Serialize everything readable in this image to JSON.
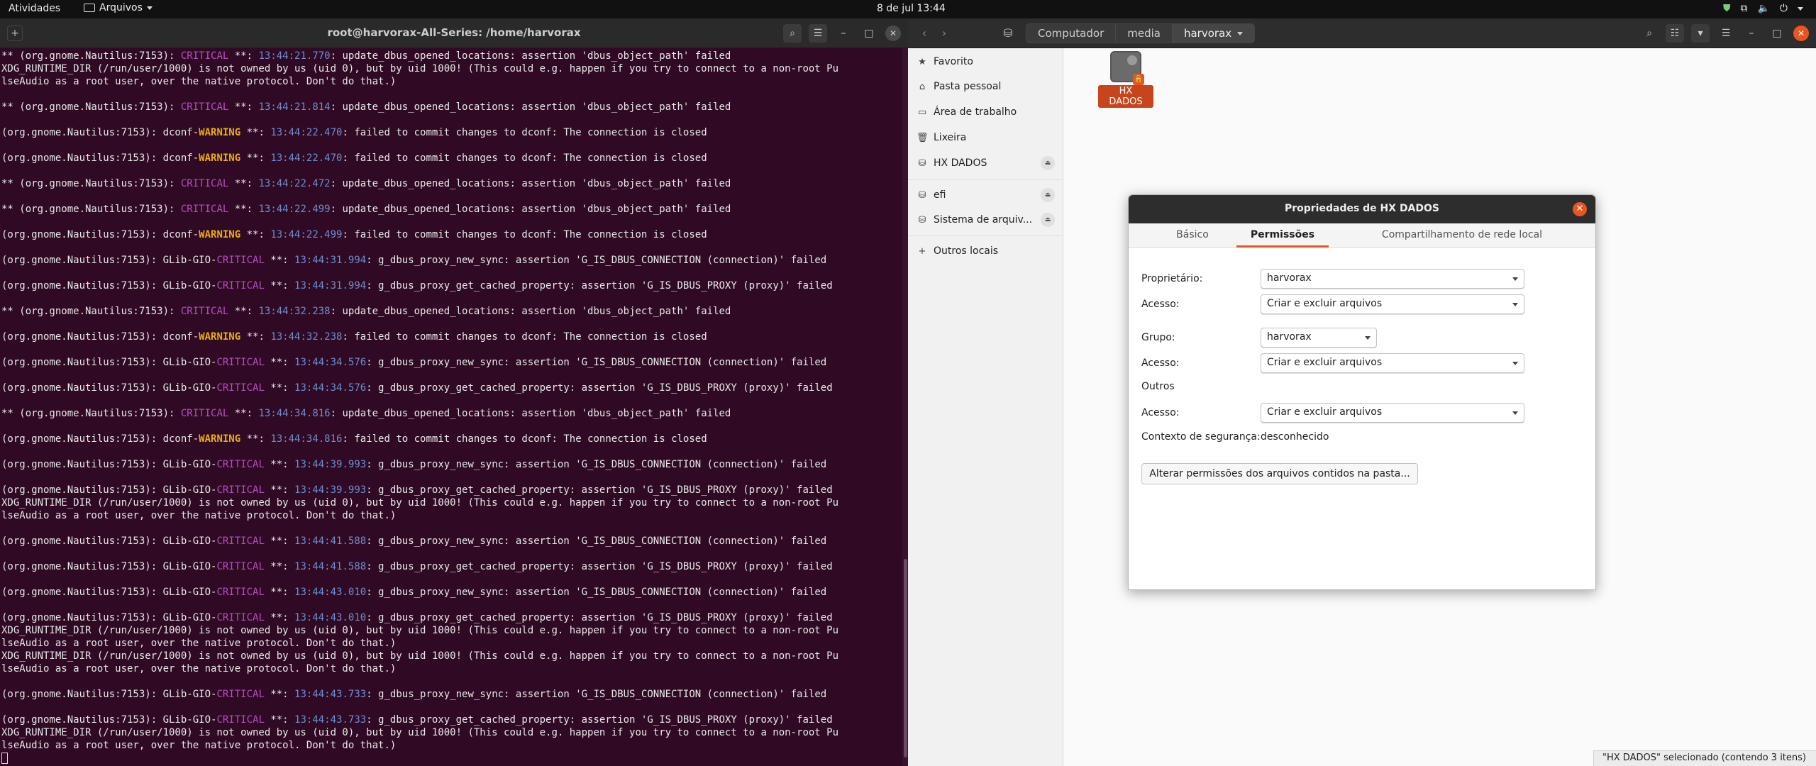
{
  "topbar": {
    "activities": "Atividades",
    "app_menu": "Arquivos",
    "clock": "8 de jul  13:44"
  },
  "terminal": {
    "title": "root@harvorax-All-Series: /home/harvorax",
    "lines": [
      [
        [
          "** (org.gnome.Nautilus:7153): ",
          ""
        ],
        [
          "CRITICAL",
          "crit"
        ],
        [
          " **: ",
          ""
        ],
        [
          "13:44:21.770",
          "ts"
        ],
        [
          ": update_dbus_opened_locations: assertion 'dbus_object_path' failed",
          ""
        ]
      ],
      [
        [
          "XDG_RUNTIME_DIR (/run/user/1000) is not owned by us (uid 0), but by uid 1000! (This could e.g. happen if you try to connect to a non-root Pu",
          ""
        ]
      ],
      [
        [
          "lseAudio as a root user, over the native protocol. Don't do that.)",
          ""
        ]
      ],
      [],
      [
        [
          "** (org.gnome.Nautilus:7153): ",
          ""
        ],
        [
          "CRITICAL",
          "crit"
        ],
        [
          " **: ",
          ""
        ],
        [
          "13:44:21.814",
          "ts"
        ],
        [
          ": update_dbus_opened_locations: assertion 'dbus_object_path' failed",
          ""
        ]
      ],
      [],
      [
        [
          "(org.gnome.Nautilus:7153): dconf-",
          ""
        ],
        [
          "WARNING",
          "warn"
        ],
        [
          " **: ",
          ""
        ],
        [
          "13:44:22.470",
          "ts"
        ],
        [
          ": failed to commit changes to dconf: The connection is closed",
          ""
        ]
      ],
      [],
      [
        [
          "(org.gnome.Nautilus:7153): dconf-",
          ""
        ],
        [
          "WARNING",
          "warn"
        ],
        [
          " **: ",
          ""
        ],
        [
          "13:44:22.470",
          "ts"
        ],
        [
          ": failed to commit changes to dconf: The connection is closed",
          ""
        ]
      ],
      [],
      [
        [
          "** (org.gnome.Nautilus:7153): ",
          ""
        ],
        [
          "CRITICAL",
          "crit"
        ],
        [
          " **: ",
          ""
        ],
        [
          "13:44:22.472",
          "ts"
        ],
        [
          ": update_dbus_opened_locations: assertion 'dbus_object_path' failed",
          ""
        ]
      ],
      [],
      [
        [
          "** (org.gnome.Nautilus:7153): ",
          ""
        ],
        [
          "CRITICAL",
          "crit"
        ],
        [
          " **: ",
          ""
        ],
        [
          "13:44:22.499",
          "ts"
        ],
        [
          ": update_dbus_opened_locations: assertion 'dbus_object_path' failed",
          ""
        ]
      ],
      [],
      [
        [
          "(org.gnome.Nautilus:7153): dconf-",
          ""
        ],
        [
          "WARNING",
          "warn"
        ],
        [
          " **: ",
          ""
        ],
        [
          "13:44:22.499",
          "ts"
        ],
        [
          ": failed to commit changes to dconf: The connection is closed",
          ""
        ]
      ],
      [],
      [
        [
          "(org.gnome.Nautilus:7153): GLib-GIO-",
          ""
        ],
        [
          "CRITICAL",
          "crit"
        ],
        [
          " **: ",
          ""
        ],
        [
          "13:44:31.994",
          "ts"
        ],
        [
          ": g_dbus_proxy_new_sync: assertion 'G_IS_DBUS_CONNECTION (connection)' failed",
          ""
        ]
      ],
      [],
      [
        [
          "(org.gnome.Nautilus:7153): GLib-GIO-",
          ""
        ],
        [
          "CRITICAL",
          "crit"
        ],
        [
          " **: ",
          ""
        ],
        [
          "13:44:31.994",
          "ts"
        ],
        [
          ": g_dbus_proxy_get_cached_property: assertion 'G_IS_DBUS_PROXY (proxy)' failed",
          ""
        ]
      ],
      [],
      [
        [
          "** (org.gnome.Nautilus:7153): ",
          ""
        ],
        [
          "CRITICAL",
          "crit"
        ],
        [
          " **: ",
          ""
        ],
        [
          "13:44:32.238",
          "ts"
        ],
        [
          ": update_dbus_opened_locations: assertion 'dbus_object_path' failed",
          ""
        ]
      ],
      [],
      [
        [
          "(org.gnome.Nautilus:7153): dconf-",
          ""
        ],
        [
          "WARNING",
          "warn"
        ],
        [
          " **: ",
          ""
        ],
        [
          "13:44:32.238",
          "ts"
        ],
        [
          ": failed to commit changes to dconf: The connection is closed",
          ""
        ]
      ],
      [],
      [
        [
          "(org.gnome.Nautilus:7153): GLib-GIO-",
          ""
        ],
        [
          "CRITICAL",
          "crit"
        ],
        [
          " **: ",
          ""
        ],
        [
          "13:44:34.576",
          "ts"
        ],
        [
          ": g_dbus_proxy_new_sync: assertion 'G_IS_DBUS_CONNECTION (connection)' failed",
          ""
        ]
      ],
      [],
      [
        [
          "(org.gnome.Nautilus:7153): GLib-GIO-",
          ""
        ],
        [
          "CRITICAL",
          "crit"
        ],
        [
          " **: ",
          ""
        ],
        [
          "13:44:34.576",
          "ts"
        ],
        [
          ": g_dbus_proxy_get_cached_property: assertion 'G_IS_DBUS_PROXY (proxy)' failed",
          ""
        ]
      ],
      [],
      [
        [
          "** (org.gnome.Nautilus:7153): ",
          ""
        ],
        [
          "CRITICAL",
          "crit"
        ],
        [
          " **: ",
          ""
        ],
        [
          "13:44:34.816",
          "ts"
        ],
        [
          ": update_dbus_opened_locations: assertion 'dbus_object_path' failed",
          ""
        ]
      ],
      [],
      [
        [
          "(org.gnome.Nautilus:7153): dconf-",
          ""
        ],
        [
          "WARNING",
          "warn"
        ],
        [
          " **: ",
          ""
        ],
        [
          "13:44:34.816",
          "ts"
        ],
        [
          ": failed to commit changes to dconf: The connection is closed",
          ""
        ]
      ],
      [],
      [
        [
          "(org.gnome.Nautilus:7153): GLib-GIO-",
          ""
        ],
        [
          "CRITICAL",
          "crit"
        ],
        [
          " **: ",
          ""
        ],
        [
          "13:44:39.993",
          "ts"
        ],
        [
          ": g_dbus_proxy_new_sync: assertion 'G_IS_DBUS_CONNECTION (connection)' failed",
          ""
        ]
      ],
      [],
      [
        [
          "(org.gnome.Nautilus:7153): GLib-GIO-",
          ""
        ],
        [
          "CRITICAL",
          "crit"
        ],
        [
          " **: ",
          ""
        ],
        [
          "13:44:39.993",
          "ts"
        ],
        [
          ": g_dbus_proxy_get_cached_property: assertion 'G_IS_DBUS_PROXY (proxy)' failed",
          ""
        ]
      ],
      [
        [
          "XDG_RUNTIME_DIR (/run/user/1000) is not owned by us (uid 0), but by uid 1000! (This could e.g. happen if you try to connect to a non-root Pu",
          ""
        ]
      ],
      [
        [
          "lseAudio as a root user, over the native protocol. Don't do that.)",
          ""
        ]
      ],
      [],
      [
        [
          "(org.gnome.Nautilus:7153): GLib-GIO-",
          ""
        ],
        [
          "CRITICAL",
          "crit"
        ],
        [
          " **: ",
          ""
        ],
        [
          "13:44:41.588",
          "ts"
        ],
        [
          ": g_dbus_proxy_new_sync: assertion 'G_IS_DBUS_CONNECTION (connection)' failed",
          ""
        ]
      ],
      [],
      [
        [
          "(org.gnome.Nautilus:7153): GLib-GIO-",
          ""
        ],
        [
          "CRITICAL",
          "crit"
        ],
        [
          " **: ",
          ""
        ],
        [
          "13:44:41.588",
          "ts"
        ],
        [
          ": g_dbus_proxy_get_cached_property: assertion 'G_IS_DBUS_PROXY (proxy)' failed",
          ""
        ]
      ],
      [],
      [
        [
          "(org.gnome.Nautilus:7153): GLib-GIO-",
          ""
        ],
        [
          "CRITICAL",
          "crit"
        ],
        [
          " **: ",
          ""
        ],
        [
          "13:44:43.010",
          "ts"
        ],
        [
          ": g_dbus_proxy_new_sync: assertion 'G_IS_DBUS_CONNECTION (connection)' failed",
          ""
        ]
      ],
      [],
      [
        [
          "(org.gnome.Nautilus:7153): GLib-GIO-",
          ""
        ],
        [
          "CRITICAL",
          "crit"
        ],
        [
          " **: ",
          ""
        ],
        [
          "13:44:43.010",
          "ts"
        ],
        [
          ": g_dbus_proxy_get_cached_property: assertion 'G_IS_DBUS_PROXY (proxy)' failed",
          ""
        ]
      ],
      [
        [
          "XDG_RUNTIME_DIR (/run/user/1000) is not owned by us (uid 0), but by uid 1000! (This could e.g. happen if you try to connect to a non-root Pu",
          ""
        ]
      ],
      [
        [
          "lseAudio as a root user, over the native protocol. Don't do that.)",
          ""
        ]
      ],
      [
        [
          "XDG_RUNTIME_DIR (/run/user/1000) is not owned by us (uid 0), but by uid 1000! (This could e.g. happen if you try to connect to a non-root Pu",
          ""
        ]
      ],
      [
        [
          "lseAudio as a root user, over the native protocol. Don't do that.)",
          ""
        ]
      ],
      [],
      [
        [
          "(org.gnome.Nautilus:7153): GLib-GIO-",
          ""
        ],
        [
          "CRITICAL",
          "crit"
        ],
        [
          " **: ",
          ""
        ],
        [
          "13:44:43.733",
          "ts"
        ],
        [
          ": g_dbus_proxy_new_sync: assertion 'G_IS_DBUS_CONNECTION (connection)' failed",
          ""
        ]
      ],
      [],
      [
        [
          "(org.gnome.Nautilus:7153): GLib-GIO-",
          ""
        ],
        [
          "CRITICAL",
          "crit"
        ],
        [
          " **: ",
          ""
        ],
        [
          "13:44:43.733",
          "ts"
        ],
        [
          ": g_dbus_proxy_get_cached_property: assertion 'G_IS_DBUS_PROXY (proxy)' failed",
          ""
        ]
      ],
      [
        [
          "XDG_RUNTIME_DIR (/run/user/1000) is not owned by us (uid 0), but by uid 1000! (This could e.g. happen if you try to connect to a non-root Pu",
          ""
        ]
      ],
      [
        [
          "lseAudio as a root user, over the native protocol. Don't do that.)",
          ""
        ]
      ]
    ]
  },
  "files": {
    "breadcrumbs": [
      "Computador",
      "media",
      "harvorax"
    ],
    "sidebar": [
      {
        "icon": "star-icon",
        "label": "Favorito"
      },
      {
        "icon": "home-icon",
        "label": "Pasta pessoal"
      },
      {
        "icon": "desktop-icon",
        "label": "Área de trabalho"
      },
      {
        "icon": "trash-icon",
        "label": "Lixeira"
      },
      {
        "icon": "drive-icon",
        "label": "HX DADOS",
        "eject": true
      },
      {
        "icon": "drive-icon",
        "label": "efi",
        "eject": true
      },
      {
        "icon": "drive-icon",
        "label": "Sistema de arquiv...",
        "eject": true
      },
      {
        "icon": "plus-icon",
        "label": "Outros locais"
      }
    ],
    "item_label": "HX DADOS",
    "status": "\"HX DADOS\" selecionado  (contendo 3 itens)"
  },
  "dialog": {
    "title": "Propriedades de HX DADOS",
    "tabs": [
      "Básico",
      "Permissões",
      "Compartilhamento de rede local"
    ],
    "active_tab": "Permissões",
    "owner_label": "Proprietário:",
    "owner_value": "harvorax",
    "access_label": "Acesso:",
    "owner_access": "Criar e excluir arquivos",
    "group_label": "Grupo:",
    "group_value": "harvorax",
    "group_access": "Criar e excluir arquivos",
    "others_label": "Outros",
    "others_access": "Criar e excluir arquivos",
    "security_label": "Contexto de segurança:",
    "security_value": "desconhecido",
    "change_button": "Alterar permissões dos arquivos contidos na pasta..."
  },
  "colors": {
    "accent": "#e95420",
    "terminal_bg": "#300a24"
  }
}
